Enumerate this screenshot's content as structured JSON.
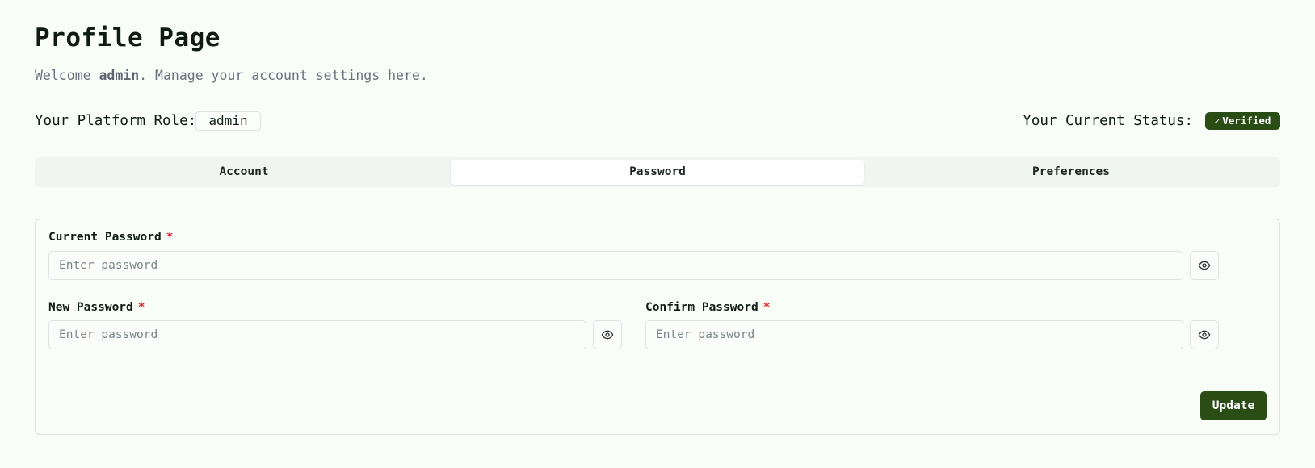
{
  "header": {
    "title": "Profile Page",
    "welcome_prefix": "Welcome ",
    "welcome_user": "admin",
    "welcome_suffix": ". Manage your account settings here."
  },
  "role": {
    "label": "Your Platform Role:",
    "value": "admin"
  },
  "status": {
    "label": "Your Current Status:",
    "badge": "Verified",
    "badge_icon": "check-icon",
    "badge_color": "#2a4d16"
  },
  "tabs": [
    {
      "label": "Account",
      "active": false
    },
    {
      "label": "Password",
      "active": true
    },
    {
      "label": "Preferences",
      "active": false
    }
  ],
  "form": {
    "current_password": {
      "label": "Current Password",
      "required": "*",
      "value": "",
      "placeholder": "Enter password"
    },
    "new_password": {
      "label": "New Password",
      "required": "*",
      "value": "",
      "placeholder": "Enter password"
    },
    "confirm_password": {
      "label": "Confirm Password",
      "required": "*",
      "value": "",
      "placeholder": "Enter password"
    },
    "toggle_icon": "eye-icon",
    "submit_label": "Update",
    "accent": "#2a4d16",
    "required_color": "#e11d2a"
  }
}
